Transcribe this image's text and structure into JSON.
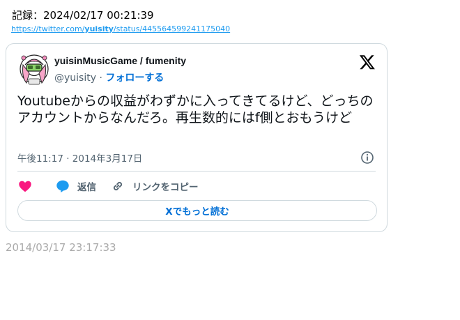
{
  "record": "記録：2024/02/17 00:21:39",
  "source": {
    "prefix": "https://twitter.com/",
    "user": "yuisity",
    "suffix": "/status/445564599241175040"
  },
  "tweet": {
    "display_name": "yuisinMusicGame / fumenity",
    "handle": "@yuisity",
    "separator": "·",
    "follow_label": "フォローする",
    "text": "Youtubeからの収益がわずかに入ってきてるけど、どっちのアカウントからなんだろ。再生数的にはf側とおもうけど",
    "timestamp": "午後11:17 · 2014年3月17日",
    "reply_label": "返信",
    "copy_label": "リンクをコピー",
    "read_more_label": "Xでもっと読む"
  },
  "footer_date": "2014/03/17 23:17:33",
  "colors": {
    "accent": "#006fd6",
    "like": "#f91880",
    "reply": "#1d9bf0",
    "border": "#cfd9de",
    "muted": "#536471"
  },
  "icons": [
    "avatar",
    "x-logo-icon",
    "info-icon",
    "heart-icon",
    "speech-bubble-icon",
    "link-icon"
  ]
}
